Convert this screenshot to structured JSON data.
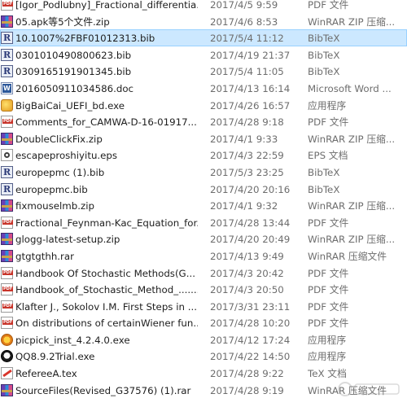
{
  "files": [
    {
      "name": "[Igor_Podlubny]_Fractional_differentia...",
      "date": "2017/4/5 9:59",
      "type": "PDF 文件",
      "icon": "pdf"
    },
    {
      "name": "05.apk等5个文件.zip",
      "date": "2017/4/6 8:53",
      "type": "WinRAR ZIP 压缩...",
      "icon": "zip"
    },
    {
      "name": "10.1007%2FBF01012313.bib",
      "date": "2017/5/4 11:12",
      "type": "BibTeX",
      "icon": "bib",
      "selected": true
    },
    {
      "name": "0301010490800623.bib",
      "date": "2017/4/19 21:37",
      "type": "BibTeX",
      "icon": "bib"
    },
    {
      "name": "0309165191901345.bib",
      "date": "2017/5/4 11:05",
      "type": "BibTeX",
      "icon": "bib"
    },
    {
      "name": "2016050911034586.doc",
      "date": "2017/4/13 16:14",
      "type": "Microsoft Word ...",
      "icon": "doc"
    },
    {
      "name": "BigBaiCai_UEFI_bd.exe",
      "date": "2017/4/26 16:57",
      "type": "应用程序",
      "icon": "exe-game"
    },
    {
      "name": "Comments_for_CAMWA-D-16-01917....",
      "date": "2017/4/28 9:18",
      "type": "PDF 文件",
      "icon": "pdf"
    },
    {
      "name": "DoubleClickFix.zip",
      "date": "2017/4/1 9:33",
      "type": "WinRAR ZIP 压缩...",
      "icon": "zip"
    },
    {
      "name": "escapeproshiyitu.eps",
      "date": "2017/4/3 22:59",
      "type": "EPS 文档",
      "icon": "eps"
    },
    {
      "name": "europepmc (1).bib",
      "date": "2017/5/3 23:25",
      "type": "BibTeX",
      "icon": "bib"
    },
    {
      "name": "europepmc.bib",
      "date": "2017/4/20 20:16",
      "type": "BibTeX",
      "icon": "bib"
    },
    {
      "name": "fixmouselmb.zip",
      "date": "2017/4/1 9:32",
      "type": "WinRAR ZIP 压缩...",
      "icon": "zip"
    },
    {
      "name": "Fractional_Feynman-Kac_Equation_for...",
      "date": "2017/4/28 13:44",
      "type": "PDF 文件",
      "icon": "pdf"
    },
    {
      "name": "glogg-latest-setup.zip",
      "date": "2017/4/20 20:49",
      "type": "WinRAR ZIP 压缩...",
      "icon": "zip"
    },
    {
      "name": "gtgtgthh.rar",
      "date": "2017/4/13 9:49",
      "type": "WinRAR 压缩文件",
      "icon": "rar"
    },
    {
      "name": "Handbook Of Stochastic Methods(G...",
      "date": "2017/4/3 20:42",
      "type": "PDF 文件",
      "icon": "pdf"
    },
    {
      "name": "Handbook_of_Stochastic_Method_.......",
      "date": "2017/4/3 20:50",
      "type": "PDF 文件",
      "icon": "pdf"
    },
    {
      "name": "Klafter J., Sokolov I.M. First Steps in ...",
      "date": "2017/3/31 23:11",
      "type": "PDF 文件",
      "icon": "pdf"
    },
    {
      "name": "On distributions of certainWiener fun...",
      "date": "2017/4/28 10:20",
      "type": "PDF 文件",
      "icon": "pdf"
    },
    {
      "name": "picpick_inst_4.2.4.0.exe",
      "date": "2017/4/12 17:24",
      "type": "应用程序",
      "icon": "exe-pick"
    },
    {
      "name": "QQ8.9.2Trial.exe",
      "date": "2017/4/22 14:50",
      "type": "应用程序",
      "icon": "exe-qq"
    },
    {
      "name": "RefereeA.tex",
      "date": "2017/4/28 9:22",
      "type": "TeX 文档",
      "icon": "tex"
    },
    {
      "name": "SourceFiles(Revised_G37576) (1).rar",
      "date": "2017/4/28 9:19",
      "type": "WinRAR 压缩文件",
      "icon": "rar"
    }
  ]
}
